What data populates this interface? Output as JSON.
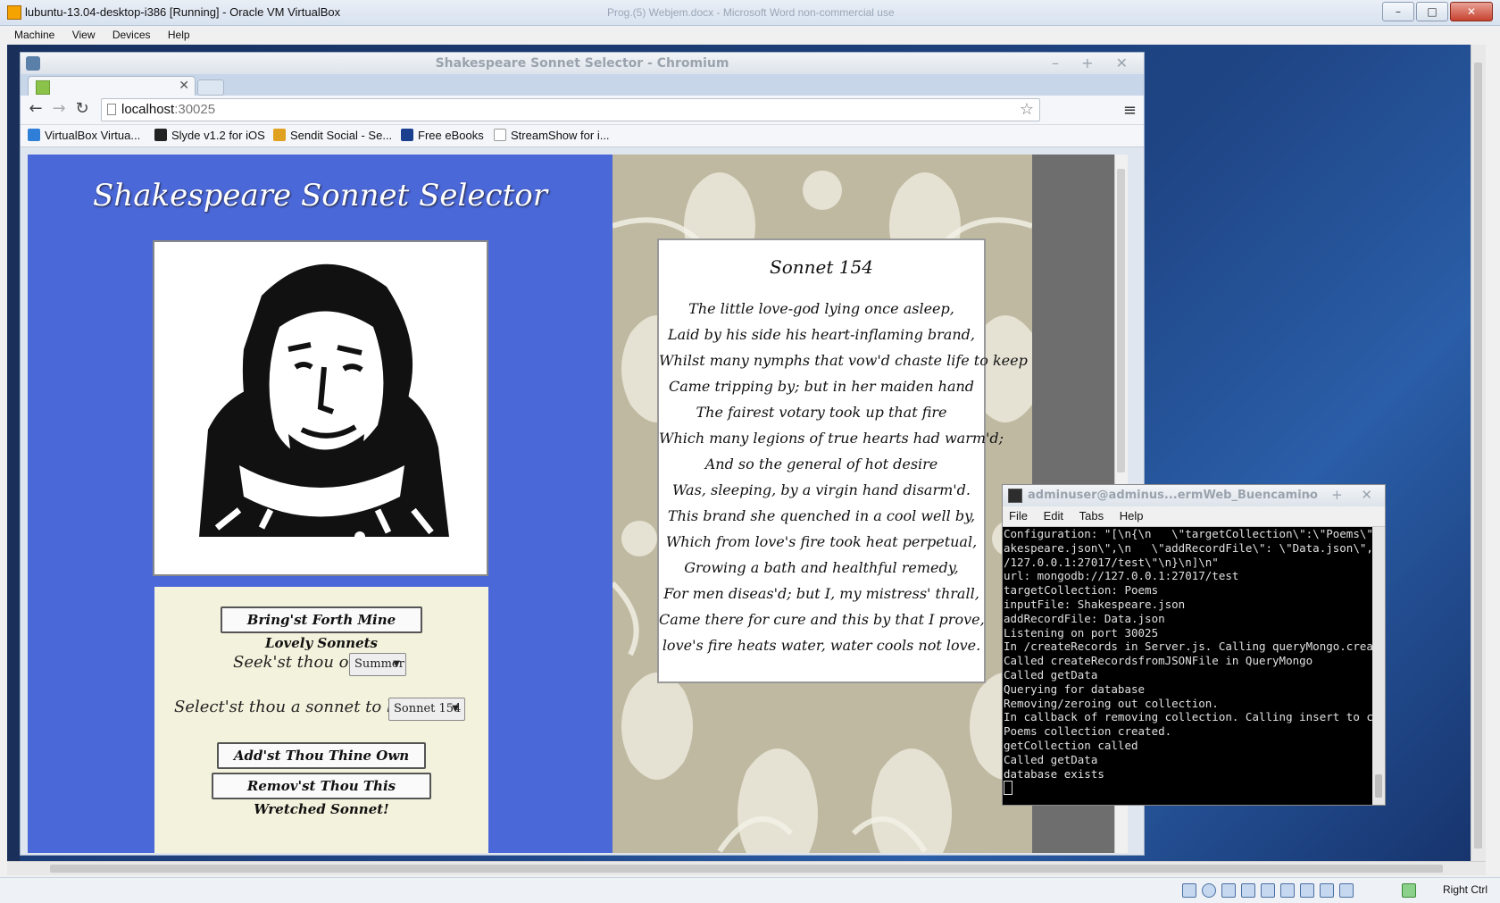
{
  "vbox": {
    "title": "lubuntu-13.04-desktop-i386 [Running] - Oracle VM VirtualBox",
    "ghost_title": "Prog.(5) Webjem.docx - Microsoft Word non-commercial use",
    "menu": [
      "Machine",
      "View",
      "Devices",
      "Help"
    ],
    "status_right": "Right Ctrl"
  },
  "chromium": {
    "title": "Shakespeare Sonnet Selector - Chromium",
    "url_host": "localhost",
    "url_port": ":30025",
    "bookmarks": [
      {
        "label": "VirtualBox Virtua...",
        "color": "#2f7fd8"
      },
      {
        "label": "Slyde v1.2 for iOS",
        "color": "#222222"
      },
      {
        "label": "Sendit Social - Se...",
        "color": "#e0a020"
      },
      {
        "label": "Free eBooks",
        "color": "#1a3f8f"
      },
      {
        "label": "StreamShow for i...",
        "color": "#ffffff"
      }
    ]
  },
  "page": {
    "title": "Shakespeare Sonnet Selector",
    "bring_button": "Bring'st Forth Mine Lovely Sonnets",
    "seek_label": "Seek'st thou on ...",
    "seek_value": "Summer",
    "select_label": "Select'st thou a sonnet to behold ...",
    "select_value": "Sonnet 154",
    "add_button": "Add'st Thou Thine Own Fair Sonnet",
    "remove_button": "Remov'st Thou This Wretched Sonnet!"
  },
  "sonnet": {
    "title": "Sonnet 154",
    "lines": [
      "The little love-god lying once asleep,",
      "Laid by his side his heart-inflaming brand,",
      "Whilst many nymphs that vow'd chaste life to keep",
      "Came tripping by; but in her maiden hand",
      "The fairest votary took up that fire",
      "Which many legions of true hearts had warm'd;",
      "And so the general of hot desire",
      "Was, sleeping, by a virgin hand disarm'd.",
      "This brand she quenched in a cool well by,",
      "Which from love's fire took heat perpetual,",
      "Growing a bath and healthful remedy,",
      "For men diseas'd; but I, my mistress' thrall,",
      "Came there for cure and this by that I prove,",
      "love's fire heats water, water cools not love."
    ]
  },
  "terminal": {
    "title": "adminuser@adminus...ermWeb_Buencamino",
    "menu": [
      "File",
      "Edit",
      "Tabs",
      "Help"
    ],
    "lines": [
      "Configuration: \"[\\n{\\n   \\\"targetCollection\\\":\\\"Poems\\\"",
      "akespeare.json\\\",\\n   \\\"addRecordFile\\\": \\\"Data.json\\\",",
      "/127.0.0.1:27017/test\\\"\\n}\\n]\\n\"",
      "url: mongodb://127.0.0.1:27017/test",
      "targetCollection: Poems",
      "inputFile: Shakespeare.json",
      "addRecordFile: Data.json",
      "Listening on port 30025",
      "In /createRecords in Server.js. Calling queryMongo.crea",
      "Called createRecordsfromJSONFile in QueryMongo",
      "Called getData",
      "Querying for database",
      "Removing/zeroing out collection.",
      "In callback of removing collection. Calling insert to c",
      "Poems collection created.",
      "getCollection called",
      "Called getData",
      "database exists"
    ]
  }
}
